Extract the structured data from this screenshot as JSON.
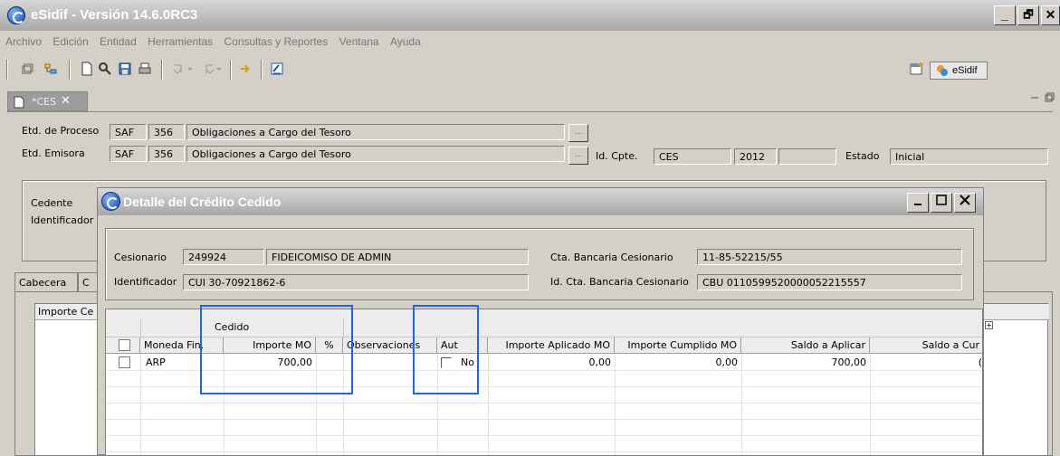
{
  "window": {
    "title": "eSidif - Versión 14.6.0RC3",
    "min": "_",
    "max": "🗗",
    "close": "✕"
  },
  "menu": [
    "Archivo",
    "Edición",
    "Entidad",
    "Herramientas",
    "Consultas y Reportes",
    "Ventana",
    "Ayuda"
  ],
  "toolbar": {
    "perspective_label": "eSidif"
  },
  "editor_tab": {
    "label": "*CES",
    "close": "✕"
  },
  "form": {
    "etd_proceso": {
      "label": "Etd. de Proceso",
      "tipo": "SAF",
      "codigo": "356",
      "descripcion": "Obligaciones a Cargo del Tesoro"
    },
    "etd_emisora": {
      "label": "Etd. Emisora",
      "tipo": "SAF",
      "codigo": "356",
      "descripcion": "Obligaciones a Cargo del Tesoro"
    },
    "id_cpte": {
      "label": "Id. Cpte.",
      "tipo": "CES",
      "anio": "2012",
      "numero": ""
    },
    "estado": {
      "label": "Estado",
      "valor": "Inicial"
    },
    "cedente_label": "Cedente",
    "identificador_label": "Identificador",
    "tabs": [
      "Cabecera",
      "C"
    ],
    "importe_col": "Importe Ce"
  },
  "dialog": {
    "title": "Detalle del Crédito Cedido",
    "cesionario_label": "Cesionario",
    "cesionario_codigo": "249924",
    "cesionario_nombre": "FIDEICOMISO DE ADMIN",
    "identificador_label": "Identificador",
    "identificador_valor": "CUI 30-70921862-6",
    "cta_bancaria_label": "Cta. Bancaria Cesionario",
    "cta_bancaria_valor": "11-85-52215/55",
    "id_cta_label": "Id. Cta. Bancaria Cesionario",
    "id_cta_valor": "CBU 0110599520000052215557",
    "table": {
      "group_header": "Cedido",
      "columns": [
        "Moneda Fin.",
        "Importe MO",
        "%",
        "Observaciones",
        "Aut",
        "Importe Aplicado MO",
        "Importe Cumplido MO",
        "Saldo a Aplicar",
        "Saldo a Cur"
      ],
      "rows": [
        {
          "moneda": "ARP",
          "importe_mo": "700,00",
          "pct": "",
          "observaciones": "",
          "aut": "No",
          "importe_aplicado": "0,00",
          "importe_cumplido": "0,00",
          "saldo_aplicar": "700,00",
          "saldo_cur": "("
        }
      ]
    }
  },
  "colors": {
    "highlight": "#2266dd",
    "titlebar": "#a8a8a8"
  }
}
